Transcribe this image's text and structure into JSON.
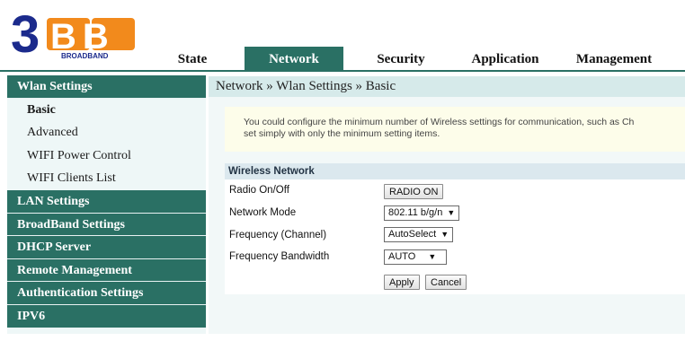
{
  "logo": {
    "digit": "3",
    "letters": "BB",
    "word": "BROADBAND"
  },
  "top_nav": {
    "tabs": [
      {
        "label": "State"
      },
      {
        "label": "Network"
      },
      {
        "label": "Security"
      },
      {
        "label": "Application"
      },
      {
        "label": "Management"
      }
    ],
    "active": "Network"
  },
  "sidebar": {
    "wlan": "Wlan Settings",
    "wlan_items": [
      "Basic",
      "Advanced",
      "WIFI Power Control",
      "WIFI Clients List"
    ],
    "sections": [
      "LAN Settings",
      "BroadBand Settings",
      "DHCP Server",
      "Remote Management",
      "Authentication Settings",
      "IPV6"
    ]
  },
  "breadcrumb": "Network » Wlan Settings » Basic",
  "notice": {
    "line1": "You could configure the minimum number of Wireless settings for communication, such as Ch",
    "line2": "set simply with only the minimum setting items."
  },
  "wireless": {
    "title": "Wireless Network",
    "radio_label": "Radio On/Off",
    "radio_button": "RADIO ON",
    "mode_label": "Network Mode",
    "mode_value": "802.11 b/g/n",
    "freq_label": "Frequency (Channel)",
    "freq_value": "AutoSelect",
    "bw_label": "Frequency Bandwidth",
    "bw_value": "AUTO",
    "apply": "Apply",
    "cancel": "Cancel"
  },
  "colors": {
    "brand_blue": "#1b2a8c",
    "brand_orange": "#f28a1c",
    "nav_green": "#2a7064"
  },
  "icons": {
    "dropdown": "caret-down-icon"
  }
}
